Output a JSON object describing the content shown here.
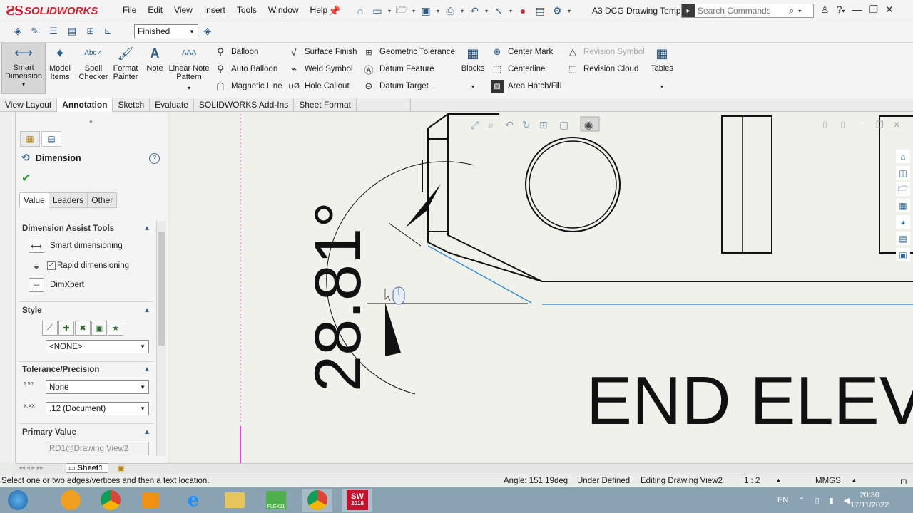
{
  "app": {
    "brand": "SOLIDWORKS",
    "document_title": "A3 DCG Drawing Temp..."
  },
  "menus": [
    "File",
    "Edit",
    "View",
    "Insert",
    "Tools",
    "Window",
    "Help"
  ],
  "search": {
    "placeholder": "Search Commands"
  },
  "layer": {
    "value": "Finished"
  },
  "ribbon": {
    "smart_dimension": "Smart Dimension",
    "model_items": "Model Items",
    "spell_checker": "Spell Checker",
    "format_painter": "Format Painter",
    "note": "Note",
    "linear_note_pattern": "Linear Note Pattern",
    "balloon": "Balloon",
    "auto_balloon": "Auto Balloon",
    "magnetic_line": "Magnetic Line",
    "surface_finish": "Surface Finish",
    "weld_symbol": "Weld Symbol",
    "hole_callout": "Hole Callout",
    "geometric_tolerance": "Geometric Tolerance",
    "datum_feature": "Datum Feature",
    "datum_target": "Datum Target",
    "blocks": "Blocks",
    "center_mark": "Center Mark",
    "centerline": "Centerline",
    "area_hatch": "Area Hatch/Fill",
    "revision_symbol": "Revision Symbol",
    "revision_cloud": "Revision Cloud",
    "tables": "Tables"
  },
  "command_tabs": [
    "View Layout",
    "Annotation",
    "Sketch",
    "Evaluate",
    "SOLIDWORKS Add-Ins",
    "Sheet Format"
  ],
  "property_manager": {
    "title": "Dimension",
    "tabs": [
      "Value",
      "Leaders",
      "Other"
    ],
    "assist_header": "Dimension Assist Tools",
    "smart_dimensioning": "Smart dimensioning",
    "rapid_dimensioning": "Rapid dimensioning",
    "rapid_checked": true,
    "dimxpert": "DimXpert",
    "style_header": "Style",
    "style_value": "<NONE>",
    "tolerance_header": "Tolerance/Precision",
    "tolerance_value": "None",
    "precision_value": ".12 (Document)",
    "tol_icon_label": "1.50",
    "prec_icon_label": "X.XX",
    "primary_header": "Primary Value",
    "primary_value": "RD1@Drawing View2"
  },
  "drawing": {
    "dimension_text": "28.81°",
    "view_label": "END ELEV"
  },
  "sheet_tab": "Sheet1",
  "status": {
    "hint": "Select one or two edges/vertices and then a text location.",
    "angle": "Angle: 151.19deg",
    "defined": "Under Defined",
    "editing": "Editing Drawing View2",
    "scale": "1 : 2",
    "units": "MMGS"
  },
  "taskbar": {
    "lang": "EN",
    "time": "20:30",
    "date": "17/11/2022",
    "sw_label": "2018",
    "flex_label": "FLEX11"
  },
  "colors": {
    "brand_red": "#d3202f",
    "accent_blue": "#2d5e8a",
    "selection_blue": "#3a8fd6",
    "sheet_border": "#e040c8"
  }
}
